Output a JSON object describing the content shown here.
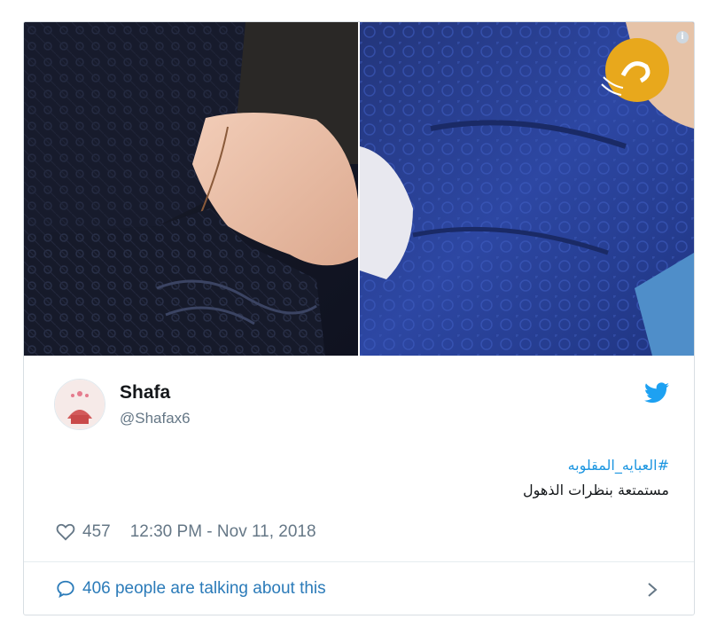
{
  "media": {
    "images": [
      {
        "name": "photo-1"
      },
      {
        "name": "photo-2"
      }
    ]
  },
  "tweet": {
    "user": {
      "display_name": "Shafa",
      "handle": "@Shafax6"
    },
    "hashtag": "#العبايه_المقلوبه",
    "text": "مستمتعة بنظرات الذهول",
    "likes": "457",
    "timestamp": "12:30 PM - Nov 11, 2018",
    "conversation": "406 people are talking about this"
  },
  "colors": {
    "link": "#1b95e0",
    "muted": "#657786",
    "twitter_blue": "#1da1f2"
  }
}
